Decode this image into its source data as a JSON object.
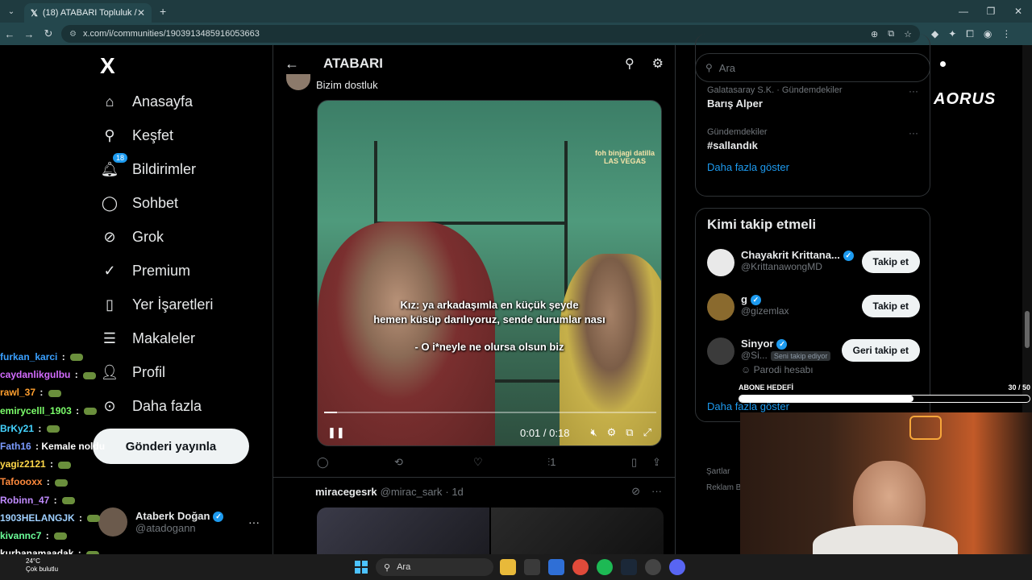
{
  "browser": {
    "tab_title": "(18) ATABARI Topluluk / X",
    "url": "x.com/i/communities/1903913485916053663"
  },
  "nav": {
    "logo": "X",
    "items": [
      {
        "label": "Anasayfa",
        "icon": "home-icon"
      },
      {
        "label": "Keşfet",
        "icon": "search-icon"
      },
      {
        "label": "Bildirimler",
        "icon": "bell-icon",
        "badge": "18"
      },
      {
        "label": "Sohbet",
        "icon": "chat-icon"
      },
      {
        "label": "Grok",
        "icon": "grok-icon"
      },
      {
        "label": "Premium",
        "icon": "premium-icon"
      },
      {
        "label": "Yer İşaretleri",
        "icon": "bookmark-icon"
      },
      {
        "label": "Makaleler",
        "icon": "article-icon"
      },
      {
        "label": "Profil",
        "icon": "profile-icon"
      },
      {
        "label": "Daha fazla",
        "icon": "more-icon"
      }
    ],
    "post_button": "Gönderi yayınla",
    "account": {
      "name": "Ataberk Doğan",
      "handle": "@atadogann"
    }
  },
  "center": {
    "title": "ATABARI",
    "tweet_text": "Bizim dostluk",
    "video": {
      "sign": "LAS VEGAS",
      "sign_small": "foh binjagi datilla",
      "subtitle1": "Kız: ya arkadaşımla en küçük şeyde",
      "subtitle2": "hemen küsüp darılıyoruz, sende durumlar nası",
      "subtitle3": "- O i*neyle ne olursa olsun biz",
      "time": "0:01 / 0:18",
      "progress": 0.04
    },
    "views": "1",
    "tweet2": {
      "name": "miracegesrk",
      "handle": "@mirac_sark",
      "time": "· 1d"
    }
  },
  "right": {
    "search_placeholder": "Ara",
    "trends": [
      {
        "category": "Galatasaray S.K. · Gündemdekiler",
        "name": "Barış Alper"
      },
      {
        "category": "Gündemdekiler",
        "name": "#sallandık"
      }
    ],
    "show_more": "Daha fazla göster",
    "who_to_follow": "Kimi takip etmeli",
    "follow": [
      {
        "name": "Chayakrit Krittana...",
        "handle": "@KrittanawongMD",
        "button": "Takip et",
        "verified": true
      },
      {
        "name": "g",
        "handle": "@gizemlax",
        "button": "Takip et",
        "verified": true
      },
      {
        "name": "Sinyor",
        "handle": "@Si...",
        "button": "Geri takip et",
        "verified": true,
        "pill": "Seni takip ediyor",
        "note": "Parodi hesabı"
      }
    ],
    "footer1": "Şartlar",
    "footer2": "Reklam Bil"
  },
  "overlay": {
    "brand": "AORUS",
    "goal_label": "ABONE HEDEFİ",
    "goal_count": "30 / 50",
    "goal_progress": 0.6,
    "chat": [
      {
        "user": "furkan_karci",
        "color": "#3aa0ff",
        "msg": ""
      },
      {
        "user": "caydanlikgulbu",
        "color": "#d46cff",
        "msg": ""
      },
      {
        "user": "rawl_37",
        "color": "#ff9f2e",
        "msg": ""
      },
      {
        "user": "emirycelll_1903",
        "color": "#7cff6b",
        "msg": ""
      },
      {
        "user": "BrKy21",
        "color": "#44d3ff",
        "msg": ""
      },
      {
        "user": "Fath16",
        "color": "#7b9bff",
        "msg": "Kemale noldu"
      },
      {
        "user": "yagiz2121",
        "color": "#ffd84a",
        "msg": ""
      },
      {
        "user": "Tafoooxx",
        "color": "#ff8a3d",
        "msg": ""
      },
      {
        "user": "Robinn_47",
        "color": "#c08bff",
        "msg": ""
      },
      {
        "user": "1903HELANGJK",
        "color": "#9fd0ff",
        "msg": ""
      },
      {
        "user": "kivannc7",
        "color": "#6cff9a",
        "msg": ""
      },
      {
        "user": "kurbanamaadak",
        "color": "#ffffff",
        "msg": ""
      }
    ]
  },
  "taskbar": {
    "weather_temp": "24°C",
    "weather_desc": "Çok bulutlu",
    "search": "Ara"
  }
}
